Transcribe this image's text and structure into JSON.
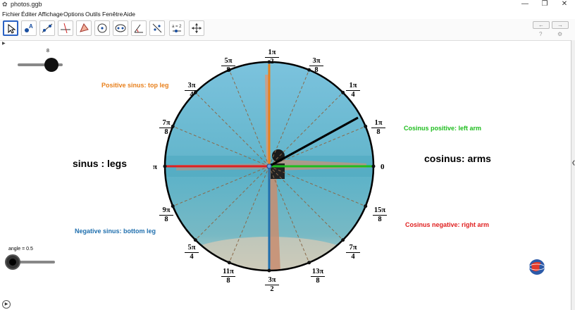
{
  "window": {
    "title": "photos.ggb",
    "minimize": "—",
    "restore": "❐",
    "close": "✕"
  },
  "menu": [
    "Fichier",
    "Éditer",
    "Affichage",
    "Options",
    "Outils",
    "Fenêtre",
    "Aide"
  ],
  "toolbar": {
    "tool_eq_label": "a = 2",
    "undo": "←",
    "redo": "→",
    "help": "?",
    "settings": "⚙"
  },
  "sliders": {
    "top_value": "8",
    "angle_label": "angle = 0.5"
  },
  "labels": {
    "positive_sinus": "Positive sinus: top leg",
    "negative_sinus": "Negative sinus: bottom leg",
    "cosinus_positive": "Cosinus positive: left arm",
    "cosinus_negative": "Cosinus negative: right arm",
    "sinus": "sinus : legs",
    "cosinus": "cosinus: arms"
  },
  "angle_labels": {
    "zero": "0",
    "pi_8": {
      "num": "1π",
      "den": "8"
    },
    "pi_4": {
      "num": "1π",
      "den": "4"
    },
    "3pi_8": {
      "num": "3π",
      "den": "8"
    },
    "pi_2": {
      "num": "1π",
      "den": "2"
    },
    "5pi_8": {
      "num": "5π",
      "den": "8"
    },
    "3pi_4": {
      "num": "3π",
      "den": "4"
    },
    "7pi_8": {
      "num": "7π",
      "den": "8"
    },
    "pi": "π",
    "9pi_8": {
      "num": "9π",
      "den": "8"
    },
    "5pi_4": {
      "num": "5π",
      "den": "4"
    },
    "11pi_8": {
      "num": "11π",
      "den": "8"
    },
    "3pi_2": {
      "num": "3π",
      "den": "2"
    },
    "13pi_8": {
      "num": "13π",
      "den": "8"
    },
    "7pi_4": {
      "num": "7π",
      "den": "4"
    },
    "15pi_8": {
      "num": "15π",
      "den": "8"
    }
  },
  "colors": {
    "orange": "#e8801c",
    "blue": "#1f6fae",
    "green": "#1ebd1e",
    "red": "#e02020",
    "sky": "#86c6de",
    "sea": "#5fb6c7"
  }
}
